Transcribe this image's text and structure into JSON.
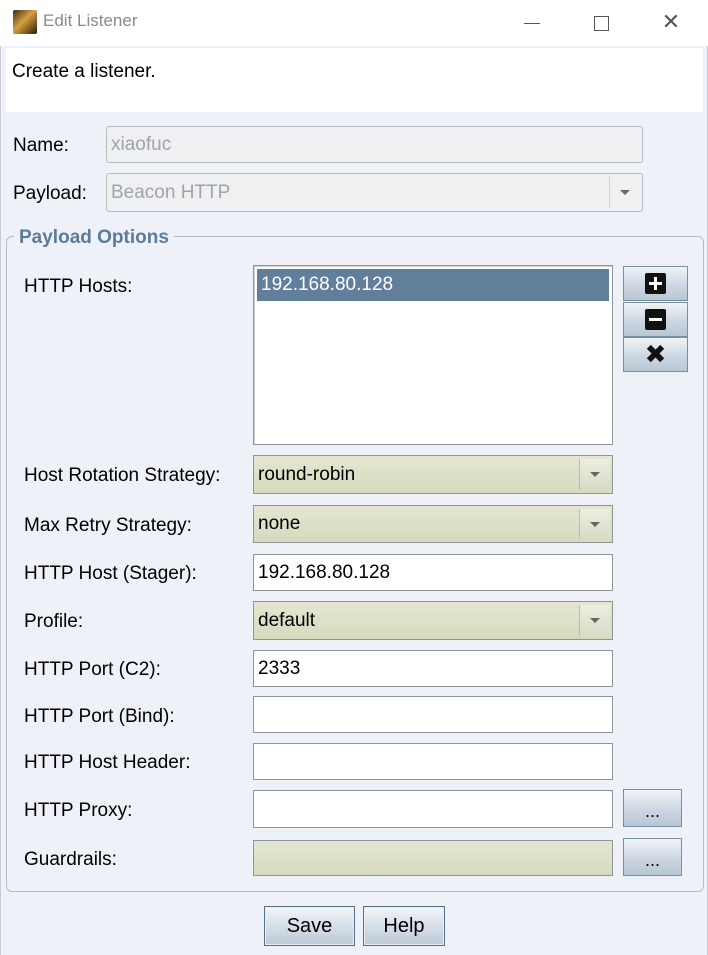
{
  "window": {
    "title": "Edit Listener",
    "minimize_glyph": "",
    "close_glyph": "✕"
  },
  "description": "Create a listener.",
  "form": {
    "name_label": "Name:",
    "name_value": "xiaofuc",
    "payload_label": "Payload:",
    "payload_value": "Beacon HTTP"
  },
  "payload_options": {
    "title": "Payload Options",
    "http_hosts_label": "HTTP Hosts:",
    "http_hosts": [
      "192.168.80.128"
    ],
    "host_buttons": [
      "add-icon",
      "remove-icon",
      "clear-icon"
    ],
    "host_rotation_label": "Host Rotation Strategy:",
    "host_rotation_value": "round-robin",
    "max_retry_label": "Max Retry Strategy:",
    "max_retry_value": "none",
    "stager_label": "HTTP Host (Stager):",
    "stager_value": "192.168.80.128",
    "profile_label": "Profile:",
    "profile_value": "default",
    "port_c2_label": "HTTP Port (C2):",
    "port_c2_value": "2333",
    "port_bind_label": "HTTP Port (Bind):",
    "port_bind_value": "",
    "host_header_label": "HTTP Host Header:",
    "host_header_value": "",
    "proxy_label": "HTTP Proxy:",
    "proxy_value": "",
    "proxy_button": "...",
    "guardrails_label": "Guardrails:",
    "guardrails_value": "",
    "guardrails_button": "..."
  },
  "buttons": {
    "save": "Save",
    "help": "Help"
  },
  "colors": {
    "selection": "#617e9b",
    "group_title": "#5b7b9a",
    "combo_bg": "#d7dabe",
    "dialog_bg": "#eef2f8"
  }
}
